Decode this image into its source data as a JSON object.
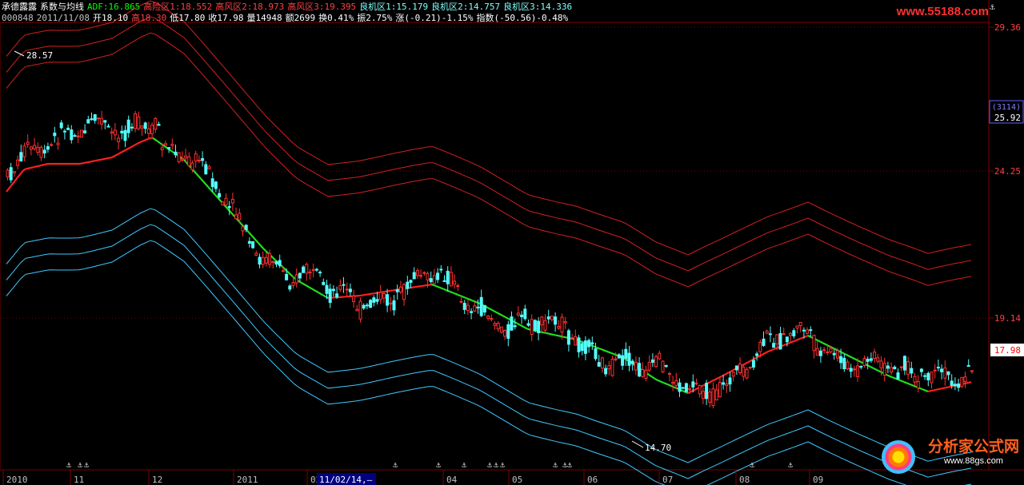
{
  "header": {
    "line1": [
      {
        "text": "承德露露",
        "color": "#ffffff"
      },
      {
        "text": "系数与均线",
        "color": "#ffffff"
      },
      {
        "text": "ADF:16.865",
        "color": "#00ff00"
      },
      {
        "text": "高险区1:18.552",
        "color": "#ff4040"
      },
      {
        "text": "高风区2:18.973",
        "color": "#ff4040"
      },
      {
        "text": "高风区3:19.395",
        "color": "#ff4040"
      },
      {
        "text": "良机区1:15.179",
        "color": "#80ffff"
      },
      {
        "text": "良机区2:14.757",
        "color": "#80ffff"
      },
      {
        "text": "良机区3:14.336",
        "color": "#80ffff"
      }
    ],
    "line2": [
      {
        "text": "000848",
        "color": "#c0c0c0"
      },
      {
        "text": "2011/11/08",
        "color": "#c0c0c0"
      },
      {
        "text": "开18.10",
        "color": "#ffffff"
      },
      {
        "text": "高18.30",
        "color": "#ff4040"
      },
      {
        "text": "低17.80",
        "color": "#ffffff"
      },
      {
        "text": "收17.98",
        "color": "#ffffff"
      },
      {
        "text": "量14948",
        "color": "#ffffff"
      },
      {
        "text": "额2699",
        "color": "#ffffff"
      },
      {
        "text": "换0.41%",
        "color": "#ffffff"
      },
      {
        "text": "振2.75%",
        "color": "#ffffff"
      },
      {
        "text": "涨(-0.21)-1.15%",
        "color": "#ffffff"
      },
      {
        "text": "指数(-50.56)-0.48%",
        "color": "#ffffff"
      }
    ]
  },
  "logo_text": "www.55188.com",
  "watermark": {
    "title": "分析家公式网",
    "url": "www.88gs.com"
  },
  "price_axis": {
    "ticks": [
      "29.36",
      "24.25",
      "19.14"
    ],
    "boxes": [
      "(3114)",
      "25.92"
    ],
    "current": "17.98"
  },
  "annotations": {
    "high": "28.57",
    "low": "14.70"
  },
  "date_axis": {
    "labels": [
      "2010",
      "11",
      "12",
      "2011",
      "02",
      "04",
      "05",
      "06",
      "07",
      "08",
      "09"
    ],
    "cursor_date": "11/02/14,—"
  },
  "colors": {
    "up": "#ff3030",
    "down": "#54fcfc",
    "ma_up": "#ff2020",
    "ma_down": "#20e020",
    "high_bands": "#d02020",
    "low_bands": "#40c8ff",
    "grid": "#800000"
  }
}
